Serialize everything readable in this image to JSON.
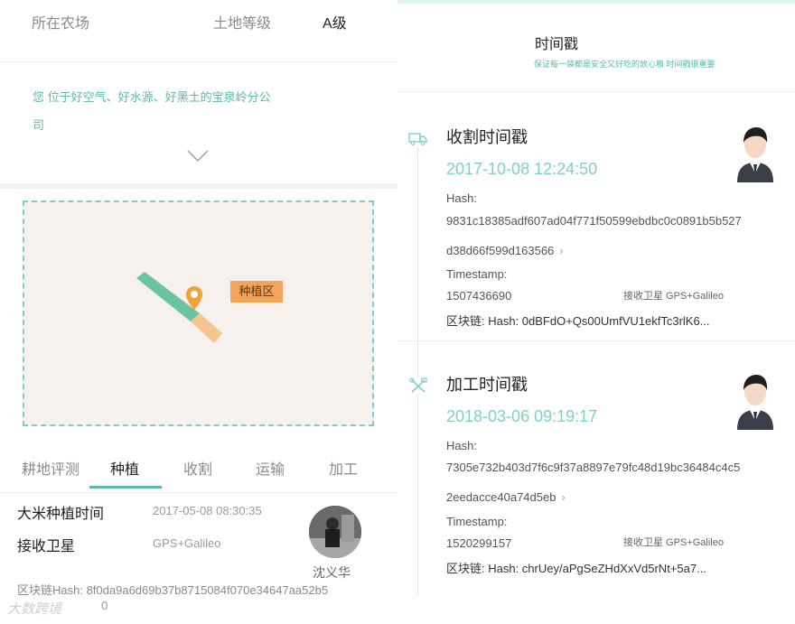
{
  "left": {
    "farm_label": "所在农场",
    "grade_label": "土地等级",
    "grade_value": "A级",
    "description_line1": "您   位于好空气、好水源、好黑土的宝泉岭分公",
    "description_line2": "司",
    "map_zone_label": "种植区",
    "tabs": [
      {
        "label": "耕地评测",
        "active": false
      },
      {
        "label": "种植",
        "active": true
      },
      {
        "label": "收割",
        "active": false
      },
      {
        "label": "运输",
        "active": false
      },
      {
        "label": "加工",
        "active": false
      }
    ],
    "planting_time_label": "大米种植时间",
    "planting_time_value": "2017-05-08 08:30:35",
    "satellite_label": "接收卫星",
    "satellite_value": "GPS+Galileo",
    "person_name": "沈义华",
    "hash_line": "区块链Hash: 8f0da9a6d69b37b8715084f070e34647aa52b5",
    "watermark": "大数跨境",
    "watermark_tail": "0"
  },
  "right": {
    "title": "时间戳",
    "subtitle": "保证每一袋都是安全又好吃的放心粮 时间戳很重要",
    "cards": [
      {
        "title": "收割时间戳",
        "time": "2017-10-08 12:24:50",
        "hash_label": "Hash:",
        "hash_line1": "9831c18385adf607ad04f771f50599ebdbc0c0891b5b527",
        "hash_line2": "d38d66f599d163566",
        "timestamp_label": "Timestamp:",
        "timestamp_value": "1507436690",
        "satellite": "接收卫星   GPS+Galileo",
        "chain_hash": "区块链: Hash: 0dBFdO+Qs00UmfVU1ekfTc3rlK6..."
      },
      {
        "title": "加工时间戳",
        "time": "2018-03-06 09:19:17",
        "hash_label": "Hash:",
        "hash_line1": "7305e732b403d7f6c9f37a8897e79fc48d19bc36484c4c5",
        "hash_line2": "2eedacce40a74d5eb",
        "timestamp_label": "Timestamp:",
        "timestamp_value": "1520299157",
        "satellite": "接收卫星   GPS+Galileo",
        "chain_hash": "区块链: Hash: chrUey/aPgSeZHdXxVd5rNt+5a7..."
      }
    ]
  },
  "colors": {
    "accent": "#5ab8b0",
    "time_accent": "#7fd1c4",
    "zone": "#f2a45a",
    "field_green": "#6cc3a0",
    "pin": "#f2a23a"
  }
}
